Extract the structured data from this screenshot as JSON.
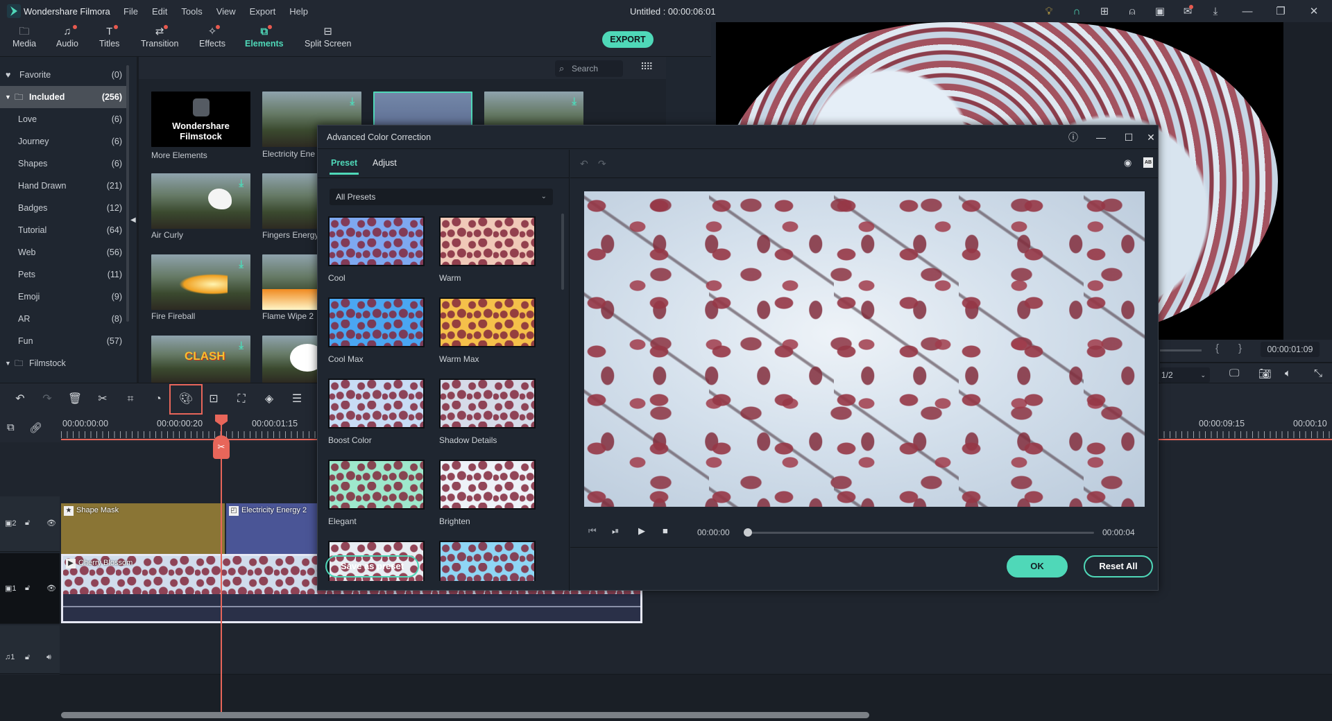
{
  "app": {
    "name": "Wondershare Filmora",
    "menu": [
      "File",
      "Edit",
      "Tools",
      "View",
      "Export",
      "Help"
    ],
    "document_title": "Untitled : 00:00:06:01",
    "title_icons": [
      "bulb-icon",
      "headset-icon",
      "gift-icon",
      "account-icon",
      "save-icon",
      "mail-icon",
      "download-icon"
    ],
    "window_controls": {
      "minimize": "—",
      "restore": "❐",
      "close": "✕"
    }
  },
  "tabs": [
    {
      "label": "Media",
      "icon": "🗀",
      "badge": false,
      "active": false
    },
    {
      "label": "Audio",
      "icon": "♫",
      "badge": true,
      "active": false
    },
    {
      "label": "Titles",
      "icon": "T",
      "badge": true,
      "active": false
    },
    {
      "label": "Transition",
      "icon": "⇄",
      "badge": true,
      "active": false
    },
    {
      "label": "Effects",
      "icon": "✧",
      "badge": true,
      "active": false
    },
    {
      "label": "Elements",
      "icon": "⧉",
      "badge": true,
      "active": true
    },
    {
      "label": "Split Screen",
      "icon": "⊟",
      "badge": false,
      "active": false
    }
  ],
  "export_label": "EXPORT",
  "sidebar": {
    "items": [
      {
        "label": "Favorite",
        "count": "(0)",
        "type": "favorite"
      },
      {
        "label": "Included",
        "count": "(256)",
        "type": "folder",
        "selected": true
      },
      {
        "label": "Love",
        "count": "(6)"
      },
      {
        "label": "Journey",
        "count": "(6)"
      },
      {
        "label": "Shapes",
        "count": "(6)"
      },
      {
        "label": "Hand Drawn",
        "count": "(21)"
      },
      {
        "label": "Badges",
        "count": "(12)"
      },
      {
        "label": "Tutorial",
        "count": "(64)"
      },
      {
        "label": "Web",
        "count": "(56)"
      },
      {
        "label": "Pets",
        "count": "(11)"
      },
      {
        "label": "Emoji",
        "count": "(9)"
      },
      {
        "label": "AR",
        "count": "(8)"
      },
      {
        "label": "Fun",
        "count": "(57)"
      },
      {
        "label": "Filmstock",
        "count": "",
        "type": "folder"
      }
    ]
  },
  "elements": {
    "search_placeholder": "Search",
    "filmstock_card": {
      "line1": "Wondershare",
      "line2": "Filmstock"
    },
    "items": [
      {
        "label": "More Elements"
      },
      {
        "label": "Electricity Ene"
      },
      {
        "label": "Air Curly"
      },
      {
        "label": "Fingers Energy"
      },
      {
        "label": "Fire Fireball"
      },
      {
        "label": "Flame Wipe 2"
      }
    ]
  },
  "dialog": {
    "title": "Advanced Color Correction",
    "tabs": [
      "Preset",
      "Adjust"
    ],
    "active_tab": "Preset",
    "preset_filter": "All Presets",
    "presets": [
      {
        "label": "Cool",
        "tint": "#7ea8f0"
      },
      {
        "label": "Warm",
        "tint": "#f0c9b8"
      },
      {
        "label": "Cool Max",
        "tint": "#4aa6f2"
      },
      {
        "label": "Warm Max",
        "tint": "#f5c04a"
      },
      {
        "label": "Boost Color",
        "tint": "#c8dcf5"
      },
      {
        "label": "Shadow Details",
        "tint": "#d6dbe8"
      },
      {
        "label": "Elegant",
        "tint": "#9ee8cc"
      },
      {
        "label": "Brighten",
        "tint": "#eef2f8"
      },
      {
        "label": "",
        "tint": "#e8edf2"
      },
      {
        "label": "",
        "tint": "#8fd6f5"
      }
    ],
    "player": {
      "current": "00:00:00",
      "duration": "00:00:04",
      "progress": 0
    },
    "buttons": {
      "save_preset": "Save as preset",
      "ok": "OK",
      "reset": "Reset All"
    }
  },
  "preview": {
    "timecode": "00:00:01:09",
    "quality": "1/2",
    "zoom_level": 0.82
  },
  "timeline": {
    "ruler": [
      "00:00:00:00",
      "00:00:00:20",
      "00:00:01:15",
      "00:00:09:15",
      "00:00:10"
    ],
    "tracks": [
      {
        "label": "2",
        "kind": "video"
      },
      {
        "label": "1",
        "kind": "video"
      },
      {
        "label": "1",
        "kind": "audio"
      }
    ],
    "clips": [
      {
        "title": "Shape Mask",
        "color": "#8a7535"
      },
      {
        "title": "Electricity Energy 2",
        "color": "#4a5596"
      },
      {
        "title": "Cherry Blossom",
        "color": "#2a3048"
      }
    ]
  }
}
